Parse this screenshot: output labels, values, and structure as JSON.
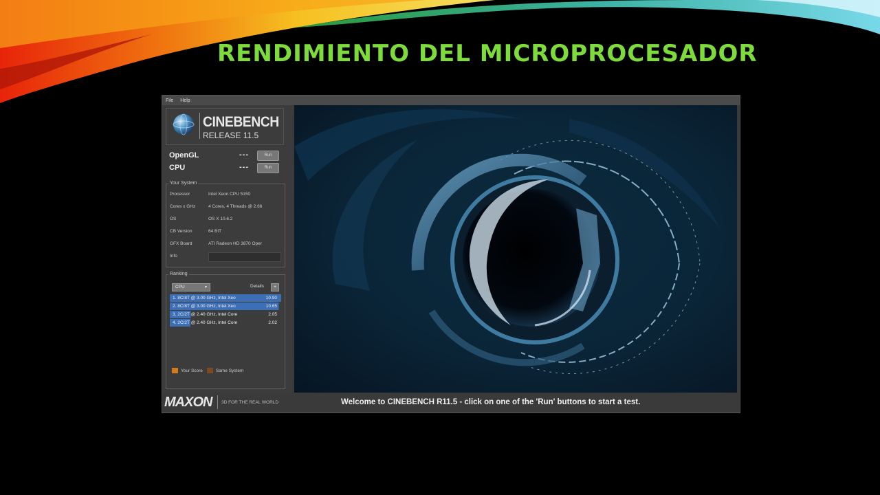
{
  "slide": {
    "title": "RENDIMIENTO DEL MICROPROCESADOR",
    "title_color": "#7ddc3b"
  },
  "app": {
    "menu": [
      "File",
      "Help"
    ],
    "logo": {
      "name": "CINEBENCH",
      "release": "RELEASE 11.5"
    },
    "benchmarks": [
      {
        "label": "OpenGL",
        "score": "---",
        "run_label": "Run"
      },
      {
        "label": "CPU",
        "score": "---",
        "run_label": "Run"
      }
    ],
    "your_system": {
      "title": "Your System",
      "rows": [
        {
          "key": "Processor",
          "value": "Intel Xeon CPU 5150"
        },
        {
          "key": "Cores x GHz",
          "value": "4 Cores, 4 Threads @ 2.66"
        },
        {
          "key": "OS",
          "value": "OS X 10.6.2"
        },
        {
          "key": "CB Version",
          "value": "64 BIT"
        },
        {
          "key": "GFX Board",
          "value": "ATI Radeon HD 3870 Oper"
        },
        {
          "key": "Info",
          "value": ""
        }
      ]
    },
    "ranking": {
      "title": "Ranking",
      "selected": "CPU",
      "details_label": "Details",
      "details_button": "+",
      "rows": [
        {
          "text": "1. 8C/8T @ 3.00 GHz, Intel Xeo",
          "score": "10.90",
          "bar": 1.0
        },
        {
          "text": "2. 8C/8T @ 3.00 GHz, Intel Xeo",
          "score": "10.65",
          "bar": 0.977
        },
        {
          "text": "3. 2C/2T @ 2.40 GHz, Intel Core",
          "score": "2.05",
          "bar": 0.188
        },
        {
          "text": "4. 2C/2T @ 2.40 GHz, Intel Core",
          "score": "2.02",
          "bar": 0.185
        }
      ],
      "legend": [
        {
          "label": "Your Score",
          "color": "#d27a1e"
        },
        {
          "label": "Same System",
          "color": "#7a4a25"
        }
      ]
    },
    "footer": {
      "brand": "MAXON",
      "tagline": "3D FOR THE REAL WORLD",
      "status": "Welcome to CINEBENCH R11.5 - click on one of the 'Run' buttons to start a test."
    }
  }
}
